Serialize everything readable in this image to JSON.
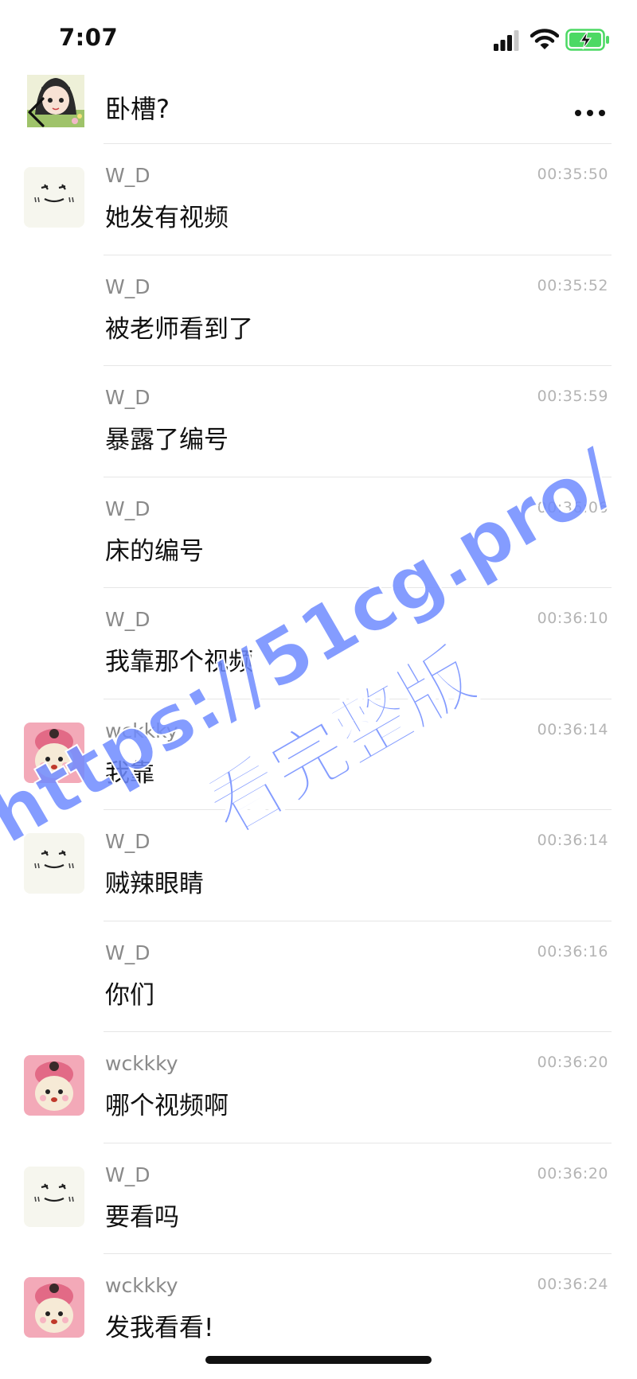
{
  "status_bar": {
    "time": "7:07",
    "icons": [
      "signal-icon",
      "wifi-icon",
      "battery-charging-icon"
    ],
    "battery_color": "#4cd964"
  },
  "header": {
    "title": "卧槽?",
    "back_icon": "chevron-left-icon",
    "more_icon": "more-icon"
  },
  "messages": [
    {
      "sender": "W_D",
      "time": "00:35:50",
      "text": "她发有视频",
      "avatar": "wd-face"
    },
    {
      "sender": "W_D",
      "time": "00:35:52",
      "text": "被老师看到了",
      "avatar": ""
    },
    {
      "sender": "W_D",
      "time": "00:35:59",
      "text": "暴露了编号",
      "avatar": ""
    },
    {
      "sender": "W_D",
      "time": "00:36:06",
      "text": "床的编号",
      "avatar": ""
    },
    {
      "sender": "W_D",
      "time": "00:36:10",
      "text": "我靠那个视频",
      "avatar": ""
    },
    {
      "sender": "wckkky",
      "time": "00:36:14",
      "text": "我靠",
      "avatar": "wckkky-bear"
    },
    {
      "sender": "W_D",
      "time": "00:36:14",
      "text": "贼辣眼睛",
      "avatar": "wd-face"
    },
    {
      "sender": "W_D",
      "time": "00:36:16",
      "text": "你们",
      "avatar": ""
    },
    {
      "sender": "wckkky",
      "time": "00:36:20",
      "text": "哪个视频啊",
      "avatar": "wckkky-bear"
    },
    {
      "sender": "W_D",
      "time": "00:36:20",
      "text": "要看吗",
      "avatar": "wd-face"
    },
    {
      "sender": "wckkky",
      "time": "00:36:24",
      "text": "发我看看!",
      "avatar": "wckkky-bear"
    }
  ],
  "watermark": {
    "line1": "https://51cg.pro/",
    "line2": "看完整版",
    "color": "#6f8bff"
  }
}
